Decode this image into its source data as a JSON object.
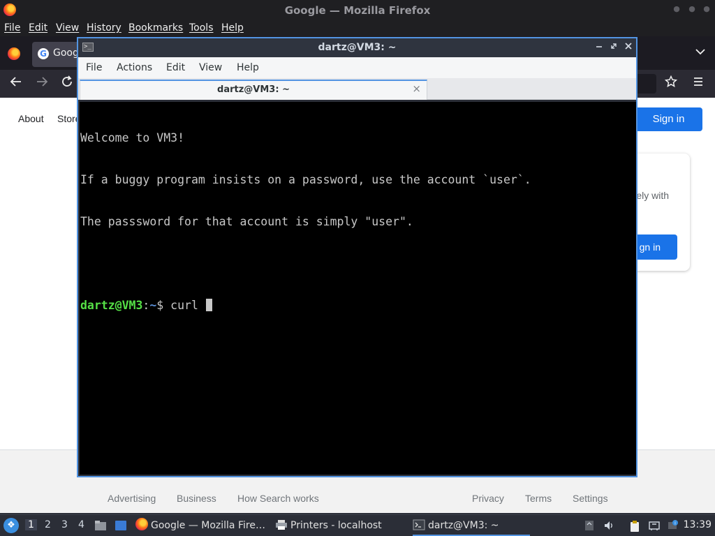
{
  "firefox": {
    "window_title": "Google — Mozilla Firefox",
    "menu": [
      "File",
      "Edit",
      "View",
      "History",
      "Bookmarks",
      "Tools",
      "Help"
    ],
    "tab_label": "Goog",
    "content": {
      "top_links": [
        "About",
        "Store"
      ],
      "sign_in": "Sign in",
      "card_text": "ely with",
      "card_button": "gn in",
      "footer_links": [
        "Advertising",
        "Business",
        "How Search works",
        "Privacy",
        "Terms",
        "Settings"
      ]
    }
  },
  "terminal": {
    "window_title": "dartz@VM3: ~",
    "menu": [
      "File",
      "Actions",
      "Edit",
      "View",
      "Help"
    ],
    "tab_label": "dartz@VM3: ~",
    "lines": [
      "Welcome to VM3!",
      "If a buggy program insists on a password, use the account `user`.",
      "The passsword for that account is simply \"user\"."
    ],
    "prompt_user": "dartz@VM3",
    "prompt_sep": ":",
    "prompt_path": "~",
    "prompt_symbol": "$ ",
    "command": "curl "
  },
  "panel": {
    "workspaces": [
      "1",
      "2",
      "3",
      "4"
    ],
    "tasks": [
      "Google — Mozilla Fire…",
      "Printers - localhost",
      "dartz@VM3: ~"
    ],
    "clock": "13:39"
  },
  "colors": {
    "accent": "#5294e2",
    "google_blue": "#1a73e8",
    "prompt_green": "#55e046",
    "prompt_blue": "#5b8fd6"
  },
  "icons": {
    "firefox": "firefox-icon",
    "google": "google-icon",
    "terminal": "terminal-icon",
    "printer": "printer-icon"
  }
}
